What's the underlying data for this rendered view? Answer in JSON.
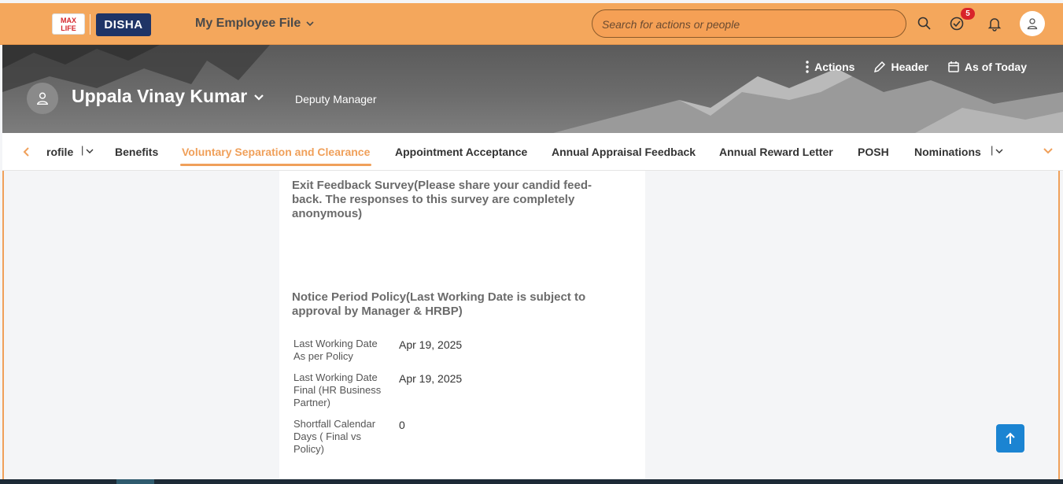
{
  "topbar": {
    "logo_max": "MAX LIFE",
    "logo_disha": "DISHA",
    "app_title": "My Employee File",
    "search_placeholder": "Search for actions or people",
    "notifications_count": "5"
  },
  "header": {
    "actions": [
      "Actions",
      "Header",
      "As of Today"
    ],
    "employee_name": "Uppala Vinay Kumar",
    "role": "Deputy Manager"
  },
  "tabs": [
    {
      "label": "rofile"
    },
    {
      "label": "Benefits"
    },
    {
      "label": "Voluntary Separation and Clearance",
      "active": true
    },
    {
      "label": "Appointment Acceptance"
    },
    {
      "label": "Annual Appraisal Feedback"
    },
    {
      "label": "Annual Reward Letter"
    },
    {
      "label": "POSH"
    },
    {
      "label": "Nominations"
    }
  ],
  "sections": {
    "exit_feedback_title": "Exit Feedback Survey(Please share your candid feed-back. The responses to this survey are completely anonymous)",
    "exit_feedback_line1": "Exit Feedback Survey(Please share your candid feed-",
    "exit_feedback_line2": "back. The responses to this survey are completely",
    "exit_feedback_line3": "anonymous)",
    "notice_line1": "Notice Period Policy(Last Working Date is subject to",
    "notice_line2": "approval by Manager & HRBP)"
  },
  "fields": [
    {
      "label": "Last Working Date As per Policy",
      "value": "Apr 19, 2025"
    },
    {
      "label": "Last Working Date Final (HR Business Partner)",
      "value": "Apr 19, 2025"
    },
    {
      "label": "Shortfall Calendar Days ( Final vs Policy)",
      "value": "0"
    }
  ],
  "colors": {
    "topbar": "#f4a75c",
    "accent": "#f0a05a",
    "scroll_button": "#1b84d2"
  }
}
